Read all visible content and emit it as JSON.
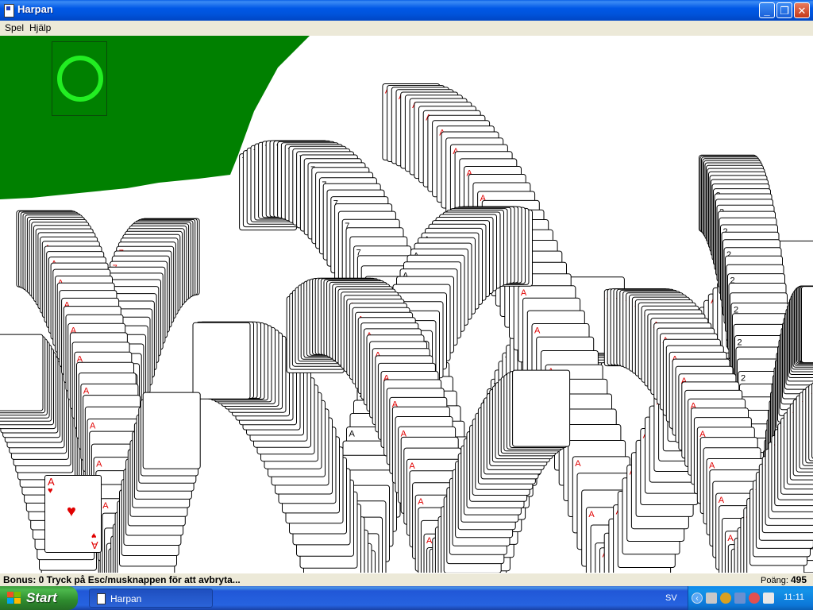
{
  "window": {
    "title": "Harpan",
    "controls": [
      "minimize",
      "maximize",
      "close"
    ]
  },
  "menu": [
    "Spel",
    "Hjälp"
  ],
  "game": {
    "felt_color": "#008000",
    "stock_marker": "green-ring-icon",
    "top_card": {
      "rank": "A",
      "suit": "♥",
      "color": "#e00000"
    }
  },
  "status": {
    "message": "Bonus: 0  Tryck på Esc/musknappen för att avbryta...",
    "score_label": "Poäng:",
    "score_value": "495"
  },
  "taskbar": {
    "start_label": "Start",
    "task_label": "Harpan",
    "language": "SV",
    "clock": "11:11"
  }
}
